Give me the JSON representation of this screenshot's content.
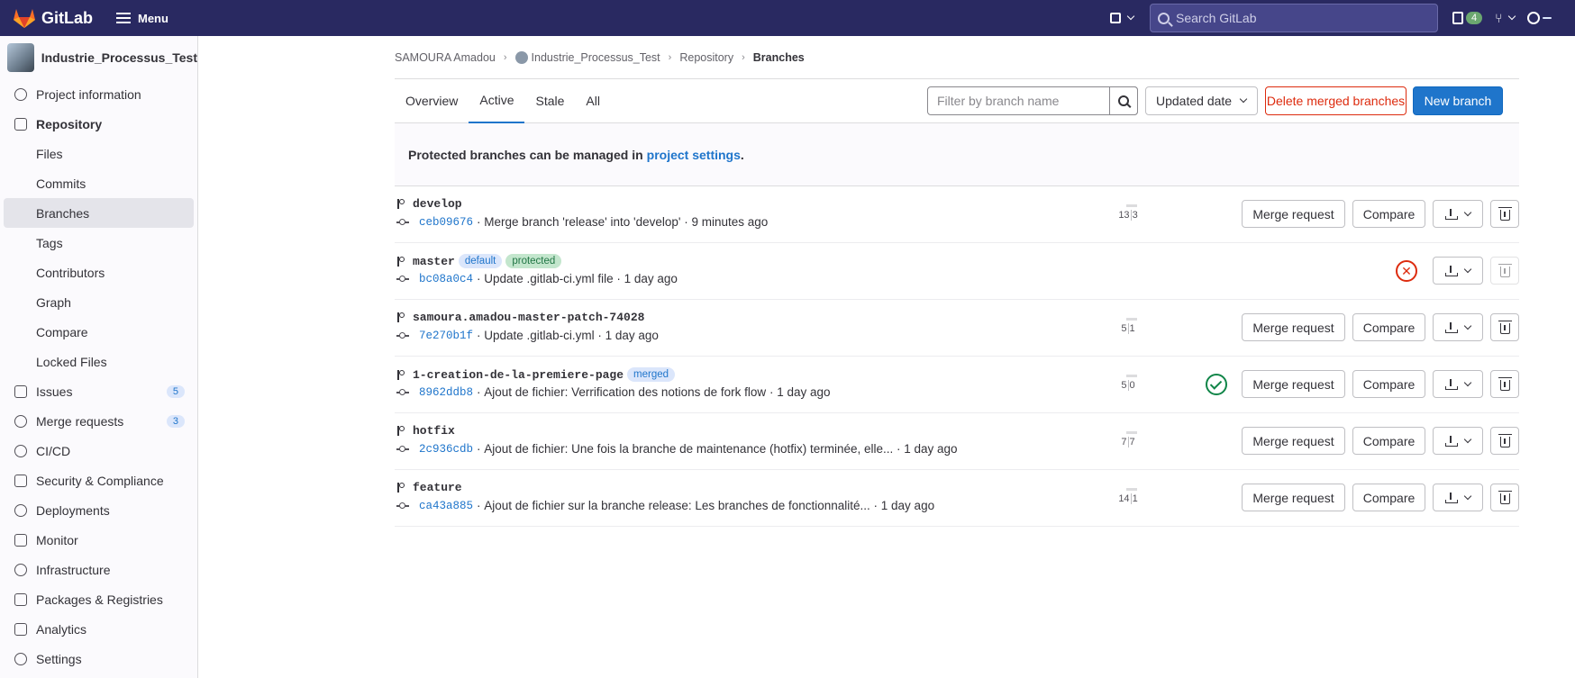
{
  "topbar": {
    "logo_text": "GitLab",
    "menu_label": "Menu",
    "search_placeholder": "Search GitLab",
    "mr_count": "4",
    "colors": {
      "background": "#292961"
    }
  },
  "sidebar": {
    "project_name": "Industrie_Processus_Test",
    "items": [
      {
        "label": "Project information",
        "icon": "info-icon"
      },
      {
        "label": "Repository",
        "icon": "document-icon"
      },
      {
        "label": "Files",
        "sub": true
      },
      {
        "label": "Commits",
        "sub": true
      },
      {
        "label": "Branches",
        "sub": true,
        "active": true
      },
      {
        "label": "Tags",
        "sub": true
      },
      {
        "label": "Contributors",
        "sub": true
      },
      {
        "label": "Graph",
        "sub": true
      },
      {
        "label": "Compare",
        "sub": true
      },
      {
        "label": "Locked Files",
        "sub": true
      },
      {
        "label": "Issues",
        "icon": "issues-icon",
        "count": "5"
      },
      {
        "label": "Merge requests",
        "icon": "merge-request-icon",
        "count": "3"
      },
      {
        "label": "CI/CD",
        "icon": "rocket-icon"
      },
      {
        "label": "Security & Compliance",
        "icon": "shield-icon"
      },
      {
        "label": "Deployments",
        "icon": "deployments-icon"
      },
      {
        "label": "Monitor",
        "icon": "monitor-icon"
      },
      {
        "label": "Infrastructure",
        "icon": "cloud-gear-icon"
      },
      {
        "label": "Packages & Registries",
        "icon": "package-icon"
      },
      {
        "label": "Analytics",
        "icon": "chart-icon"
      },
      {
        "label": "Settings",
        "icon": "gear-icon"
      }
    ]
  },
  "breadcrumb": {
    "user": "SAMOURA Amadou",
    "project": "Industrie_Processus_Test",
    "section": "Repository",
    "current": "Branches"
  },
  "tabs": [
    "Overview",
    "Active",
    "Stale",
    "All"
  ],
  "toolbar": {
    "filter_placeholder": "Filter by branch name",
    "sort_label": "Updated date",
    "delete_merged_label": "Delete merged branches",
    "new_branch_label": "New branch"
  },
  "info": {
    "text": "Protected branches can be managed in",
    "link": "project settings",
    "suffix": "."
  },
  "buttons": {
    "merge_request": "Merge request",
    "compare": "Compare"
  },
  "branches": [
    {
      "name": "develop",
      "sha": "ceb09676",
      "message": "Merge branch 'release' into 'develop'",
      "time": "9 minutes ago",
      "behind": "13",
      "ahead": "3",
      "tags": [],
      "pipeline": ""
    },
    {
      "name": "master",
      "sha": "bc08a0c4",
      "message": "Update .gitlab-ci.yml file",
      "time": "1 day ago",
      "behind": "",
      "ahead": "",
      "tags": [
        "default",
        "protected"
      ],
      "pipeline": "failed"
    },
    {
      "name": "samoura.amadou-master-patch-74028",
      "sha": "7e270b1f",
      "message": "Update .gitlab-ci.yml",
      "time": "1 day ago",
      "behind": "5",
      "ahead": "1",
      "tags": [],
      "pipeline": ""
    },
    {
      "name": "1-creation-de-la-premiere-page",
      "sha": "8962ddb8",
      "message": "Ajout de fichier: Verrification des notions de fork flow",
      "time": "1 day ago",
      "behind": "5",
      "ahead": "0",
      "tags": [
        "merged"
      ],
      "pipeline": "passed"
    },
    {
      "name": "hotfix",
      "sha": "2c936cdb",
      "message": "Ajout de fichier: Une fois la branche de maintenance (hotfix) terminée, elle...",
      "time": "1 day ago",
      "behind": "7",
      "ahead": "7",
      "tags": [],
      "pipeline": ""
    },
    {
      "name": "feature",
      "sha": "ca43a885",
      "message": "Ajout de fichier sur la branche release: Les branches de fonctionnalité...",
      "time": "1 day ago",
      "behind": "14",
      "ahead": "1",
      "tags": [],
      "pipeline": ""
    }
  ]
}
